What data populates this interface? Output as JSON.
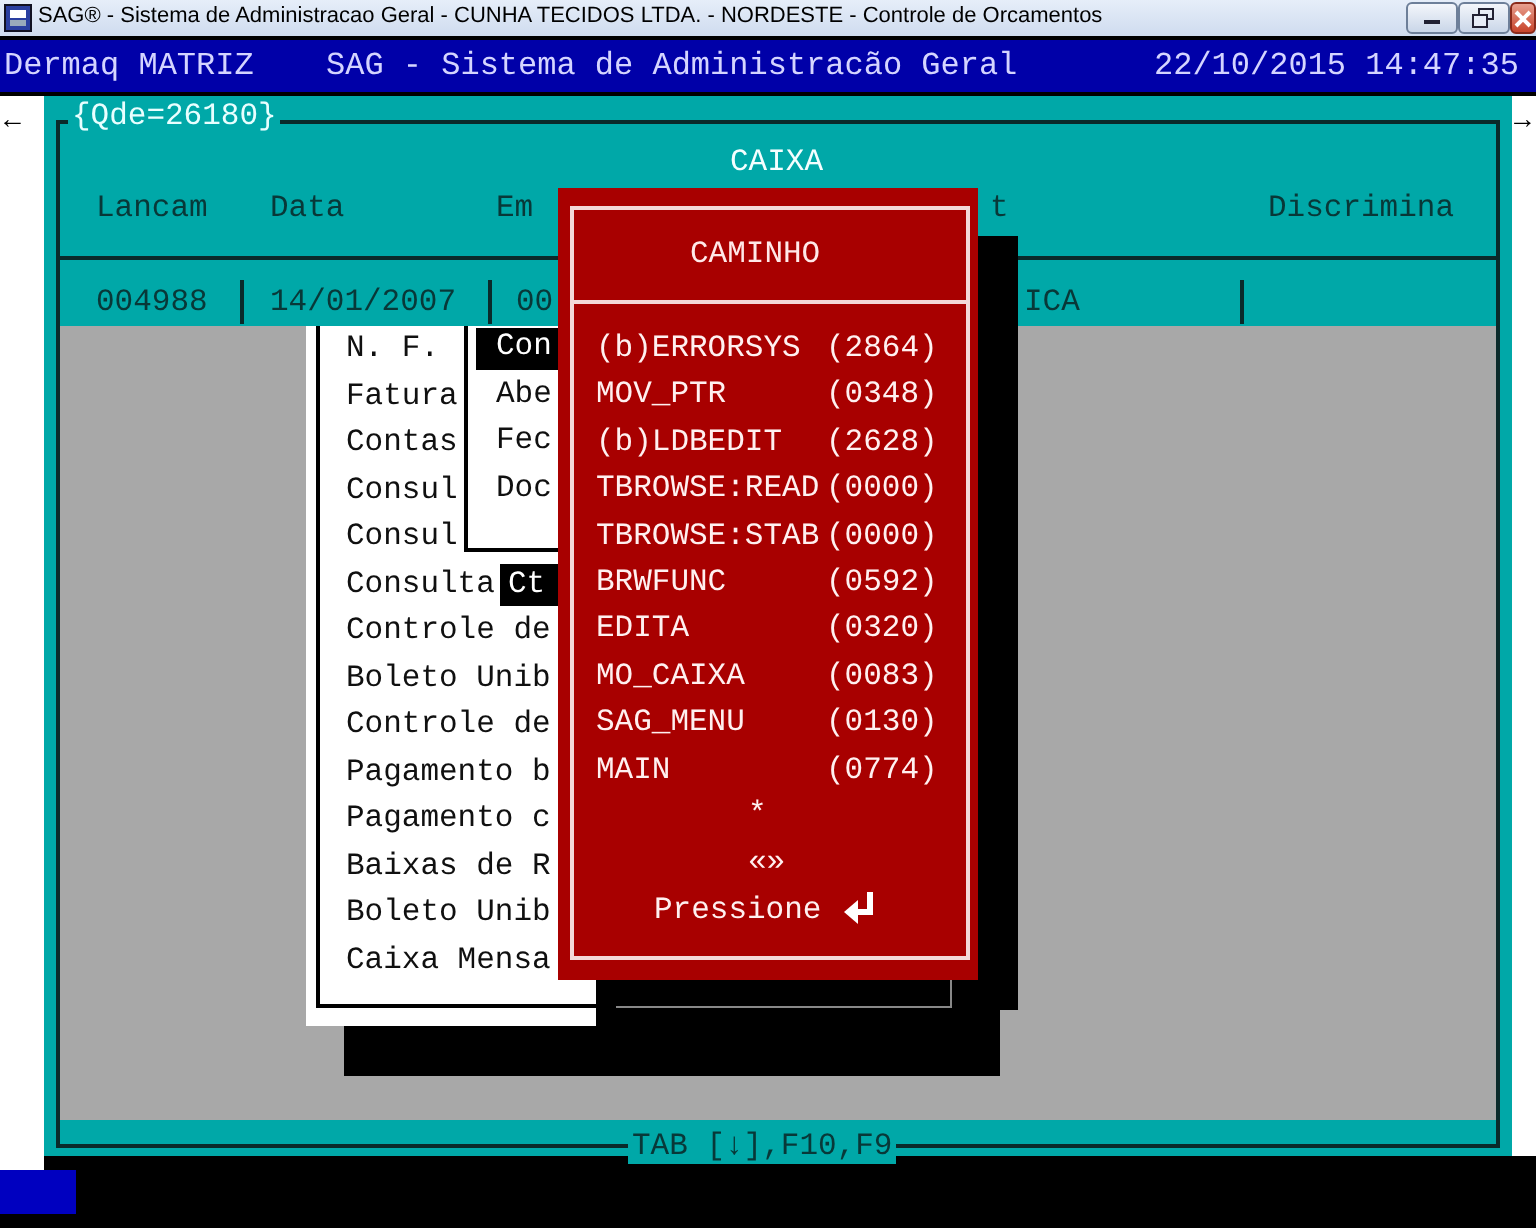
{
  "window": {
    "title": "SAG® - Sistema de Administracao Geral - CUNHA TECIDOS LTDA. - NORDESTE - Controle de Orcamentos"
  },
  "header": {
    "left": "Dermaq MATRIZ",
    "center": "SAG - Sistema de Administracão Geral",
    "right": "22/10/2015 14:47:35"
  },
  "scroll": {
    "left": "←",
    "right": "→"
  },
  "browse": {
    "frame_label": "{Qde=26180}",
    "title": "CAIXA",
    "columns": [
      {
        "label": "Lancam"
      },
      {
        "label": "Data"
      },
      {
        "label": "Em"
      },
      {
        "label": "t"
      },
      {
        "label": "Discrimina"
      }
    ],
    "rows": [
      {
        "cells": [
          "004988",
          "14/01/2007",
          "00",
          "ICA"
        ]
      }
    ],
    "footer": "TAB [↓],F10,F9"
  },
  "menu": {
    "items": [
      "N. F.",
      "Fatura",
      "Contas",
      "Consul",
      "Consul",
      "Consulta",
      "Controle de",
      "Boleto Unib",
      "Controle de",
      "Pagamento b",
      "Pagamento c",
      "Baixas de R",
      "Boleto Unib",
      "Caixa Mensa"
    ]
  },
  "submenu": {
    "items": [
      {
        "label": "Con",
        "selected": true
      },
      {
        "label": "Abe",
        "selected": false
      },
      {
        "label": "Fec",
        "selected": false
      },
      {
        "label": "Doc",
        "selected": false
      }
    ]
  },
  "submenu_fragment": {
    "label": "Ct",
    "selected": true
  },
  "dialog": {
    "title": "CAMINHO",
    "entries": [
      {
        "name": "(b)ERRORSYS",
        "count": "(2864)"
      },
      {
        "name": "MOV_PTR",
        "count": "(0348)"
      },
      {
        "name": "(b)LDBEDIT",
        "count": "(2628)"
      },
      {
        "name": "TBROWSE:READ",
        "count": "(0000)"
      },
      {
        "name": "TBROWSE:STAB",
        "count": "(0000)"
      },
      {
        "name": "BRWFUNC",
        "count": "(0592)"
      },
      {
        "name": "EDITA",
        "count": "(0320)"
      },
      {
        "name": "MO_CAIXA",
        "count": "(0083)"
      },
      {
        "name": "SAG_MENU",
        "count": "(0130)"
      },
      {
        "name": "MAIN",
        "count": "(0774)"
      }
    ],
    "marker": "*",
    "separator": "«»",
    "prompt": "Pressione"
  }
}
